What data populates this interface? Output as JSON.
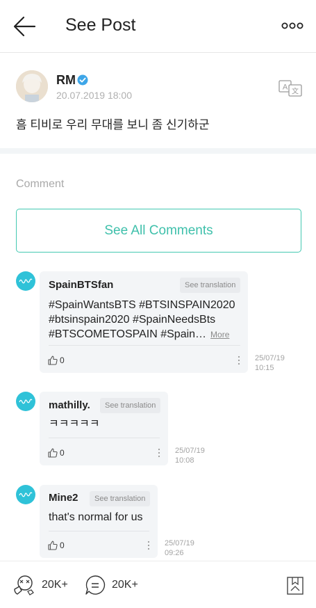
{
  "header": {
    "back_icon": "arrow-left-icon",
    "title": "See Post",
    "more_icon": "more-dots-icon"
  },
  "post": {
    "author": "RM",
    "verified_icon": "verified-check-icon",
    "date": "20.07.2019 18:00",
    "translate_icon": "translate-icon",
    "text": "흠 티비로 우리 무대를 보니 좀 신기하군"
  },
  "comments_section": {
    "label": "Comment",
    "see_all_label": "See All Comments",
    "translate_label": "See translation",
    "more_label": "More",
    "accent_color": "#43c8b1",
    "avatar_color": "#2fc2d8",
    "items": [
      {
        "user": "SpainBTSfan",
        "lines": [
          "#SpainWantsBTS #BTSINSPAIN2020",
          "#btsinspain2020 #SpainNeedsBts",
          "#BTSCOMETOSPAIN #Spain…"
        ],
        "likes": "0",
        "date": "25/07/19",
        "time": "10:15"
      },
      {
        "user": "mathilly.",
        "lines": [
          "ㅋㅋㅋㅋㅋ"
        ],
        "likes": "0",
        "date": "25/07/19",
        "time": "10:08"
      },
      {
        "user": "Mine2",
        "lines": [
          "that's normal for us"
        ],
        "likes": "0",
        "date": "25/07/19",
        "time": "09:26"
      }
    ]
  },
  "footer": {
    "likes_icon": "like-cheer-icon",
    "likes_count": "20K+",
    "comments_icon": "comment-bubble-icon",
    "comments_count": "20K+",
    "bookmark_icon": "bookmark-icon"
  }
}
